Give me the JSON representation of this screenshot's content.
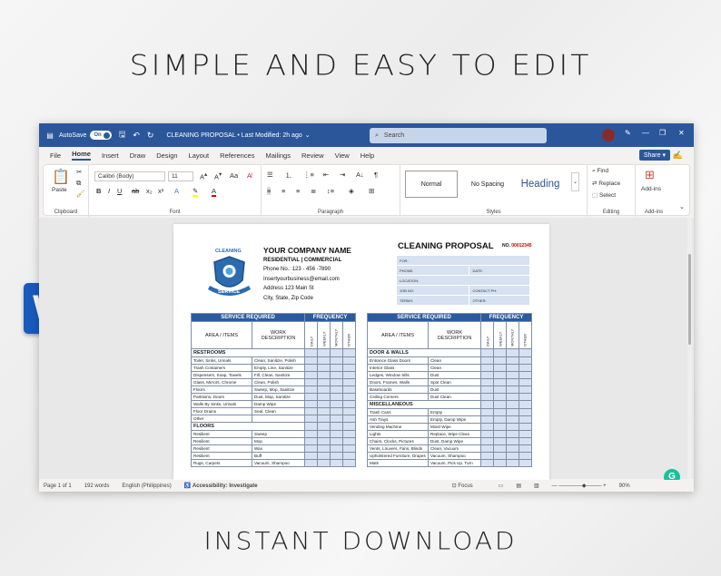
{
  "headline_top": "SIMPLE AND EASY TO EDIT",
  "headline_bottom": "INSTANT DOWNLOAD",
  "word_logo_letter": "W",
  "titlebar": {
    "autosave": "AutoSave",
    "toggle": "On",
    "doc_title": "CLEANING PROPOSAL • Last Modified: 2h ago",
    "search_placeholder": "Search"
  },
  "menu": [
    "File",
    "Home",
    "Insert",
    "Draw",
    "Design",
    "Layout",
    "References",
    "Mailings",
    "Review",
    "View",
    "Help"
  ],
  "share": "Share",
  "ribbon": {
    "paste": "Paste",
    "font_name": "Calibri (Body)",
    "font_size": "11",
    "styles": [
      "Normal",
      "No Spacing",
      "Heading"
    ],
    "find": "Find",
    "replace": "Replace",
    "select": "Select",
    "addins": "Add-ins",
    "groups": [
      "Clipboard",
      "Font",
      "Paragraph",
      "Styles",
      "Editing",
      "Add-ins"
    ]
  },
  "status": {
    "page": "Page 1 of 1",
    "words": "192 words",
    "lang": "English (Philippines)",
    "access": "Accessibility: Investigate",
    "focus": "Focus",
    "zoom": "90%"
  },
  "doc": {
    "badge_top": "CLEANING",
    "badge_bottom": "SERVICE",
    "company": "YOUR COMPANY NAME",
    "type": "RESIDENTIAL | COMMERCIAL",
    "phone": "Phone No.: 123 - 456 -7890",
    "email": "Insertyourbusiness@email.com",
    "address1": "Address 123 Main St",
    "address2": "City, State, Zip Code",
    "title": "CLEANING PROPOSAL",
    "no_label": "NO.",
    "no_value": "00012345",
    "form": {
      "for": "FOR:",
      "phone": "PHONE:",
      "date": "DATE:",
      "location": "LOCATION:",
      "job": "JOB NO:",
      "contact": "CONTACT PH:",
      "terms": "TERMS:",
      "other": "OTHER:"
    },
    "service_required": "SERVICE REQUIRED",
    "frequency": "FREQUENCY",
    "area": "AREA / ITEMS",
    "work": "WORK DESCRIPTION",
    "freq": [
      "DAILY",
      "WEEKLY",
      "MONTHLY",
      "OTHER"
    ],
    "left_sections": [
      {
        "name": "RESTROOMS",
        "rows": [
          [
            "Toilet, Sinks, Urinals",
            "Clean, Sanitize, Polish"
          ],
          [
            "Trash Containers",
            "Empty, Line, Sanitize"
          ],
          [
            "Dispensers, Soap, Towels",
            "Fill, Clean, Sanitize"
          ],
          [
            "Glass, Mirrors, Chrome",
            "Clean, Polish"
          ],
          [
            "Floors",
            "Sweep, Mop, Sanitize"
          ],
          [
            "Partitions, Doors",
            "Dust, Mop, Sanitize"
          ],
          [
            "Walls By Sinks, Urinals",
            "Damp Wipe"
          ],
          [
            "Floor Drains",
            "Seal, Clean"
          ],
          [
            "Other",
            ""
          ]
        ]
      },
      {
        "name": "FLOORS",
        "rows": [
          [
            "Resilient",
            "Sweep"
          ],
          [
            "Resilient",
            "Mop"
          ],
          [
            "Resilient",
            "Wax"
          ],
          [
            "Resilient",
            "Buff"
          ],
          [
            "Rugs, Carpets",
            "Vacuum, Shampoo"
          ]
        ]
      }
    ],
    "right_sections": [
      {
        "name": "DOOR & WALLS",
        "rows": [
          [
            "Entrance Glass Doors",
            "Clean"
          ],
          [
            "Interior Glass",
            "Clean"
          ],
          [
            "Ledges, Window Sills",
            "Dust"
          ],
          [
            "Doors, Frames, Walls",
            "Spot Clean"
          ],
          [
            "Baseboards",
            "Dust"
          ],
          [
            "Ceiling Corners",
            "Dust Clean"
          ]
        ]
      },
      {
        "name": "MISCELLANEOUS",
        "rows": [
          [
            "Trash Cans",
            "Empty"
          ],
          [
            "Ash Trays",
            "Empty, Damp Wipe"
          ],
          [
            "Vending Machine",
            "Moist Wipe"
          ],
          [
            "Lights",
            "Replace, Wipe Clean"
          ],
          [
            "Chairs, Clocks, Pictures",
            "Dust, Damp Wipe"
          ],
          [
            "Vents, Louvers, Fans, Blinds",
            "Clean, Vacuum"
          ],
          [
            "Upholstered Furniture, Drapes",
            "Vacuum, Shampoo"
          ],
          [
            "Mats",
            "Vacuum, Pick Up, Turn"
          ]
        ]
      }
    ]
  }
}
